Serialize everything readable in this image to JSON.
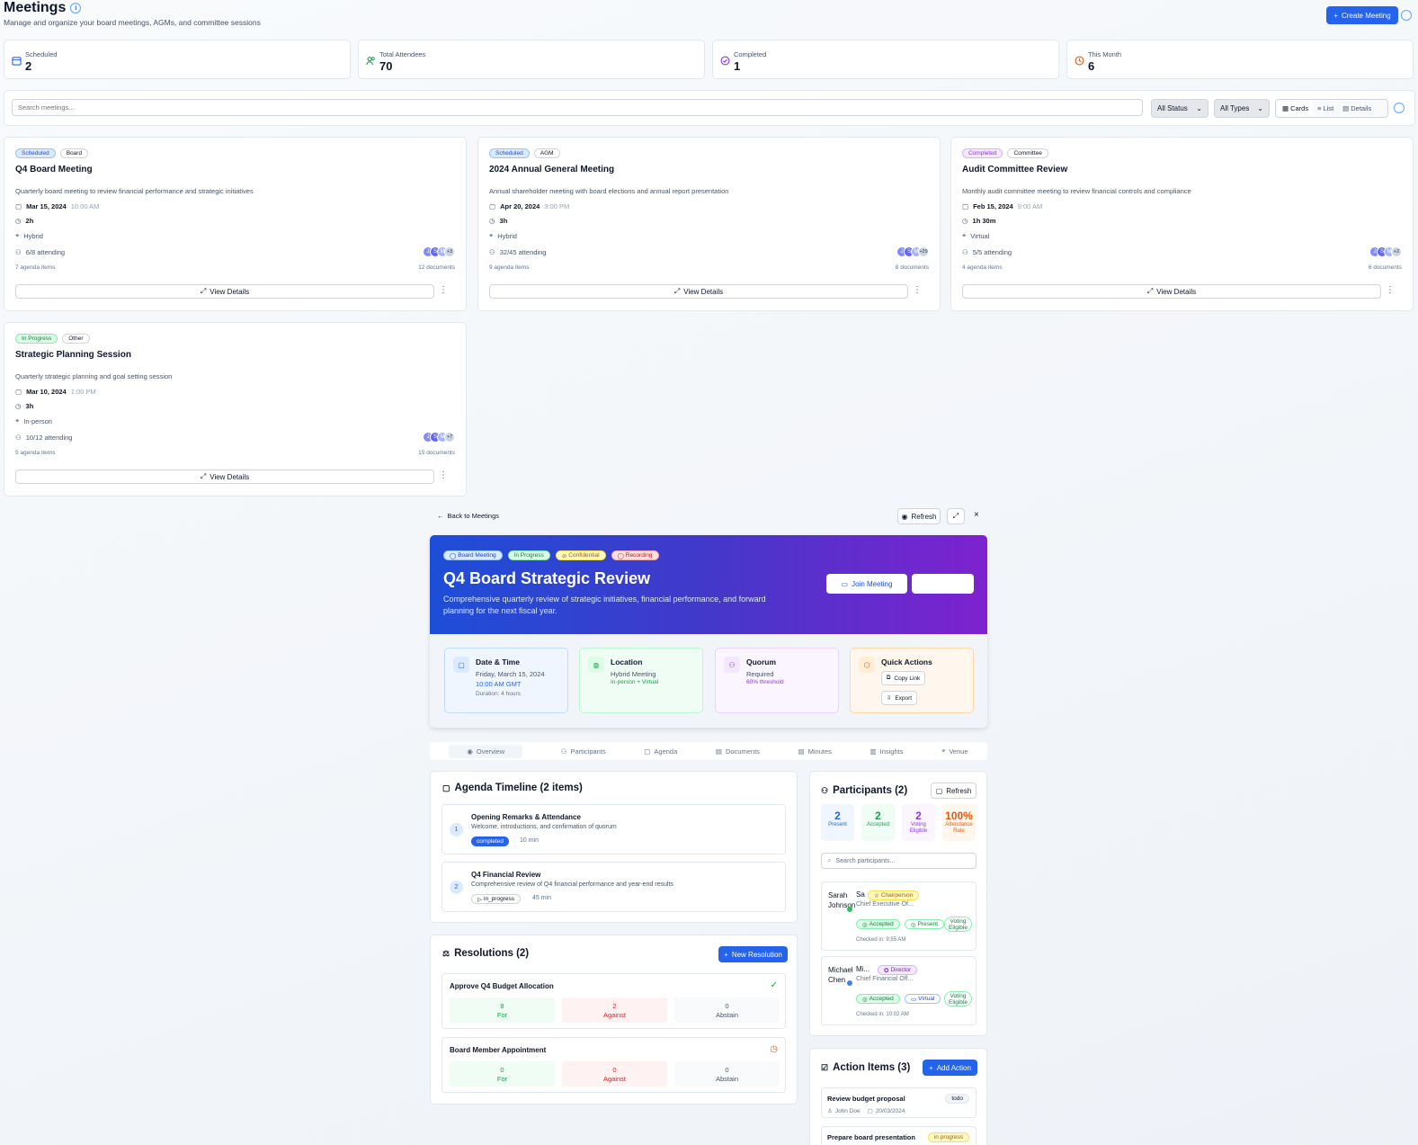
{
  "header": {
    "title": "Meetings",
    "subtitle": "Manage and organize your board meetings, AGMs, and committee sessions",
    "create_label": "Create Meeting"
  },
  "stats": [
    {
      "label": "Scheduled",
      "value": "2",
      "icon": "calendar-icon",
      "color": "#2563eb"
    },
    {
      "label": "Total Attendees",
      "value": "70",
      "icon": "users-icon",
      "color": "#16a34a"
    },
    {
      "label": "Completed",
      "value": "1",
      "icon": "check-circle-icon",
      "color": "#9333ea"
    },
    {
      "label": "This Month",
      "value": "6",
      "icon": "clock-icon",
      "color": "#ea580c"
    }
  ],
  "filters": {
    "search_placeholder": "Search meetings...",
    "status": "All Status",
    "type": "All Types",
    "views": [
      "Cards",
      "List",
      "Details"
    ]
  },
  "meetings": [
    {
      "status": "Scheduled",
      "type": "Board",
      "title": "Q4 Board Meeting",
      "desc": "Quarterly board meeting to review financial performance and strategic initiatives",
      "date": "Mar 15, 2024",
      "time": "10:00 AM",
      "duration": "2h",
      "location": "Hybrid",
      "attending": "6/8 attending",
      "more": "+3",
      "agenda": "7 agenda items",
      "docs": "12 documents"
    },
    {
      "status": "Scheduled",
      "type": "AGM",
      "title": "2024 Annual General Meeting",
      "desc": "Annual shareholder meeting with board elections and annual report presentation",
      "date": "Apr 20, 2024",
      "time": "3:00 PM",
      "duration": "3h",
      "location": "Hybrid",
      "attending": "32/45 attending",
      "more": "+29",
      "agenda": "9 agenda items",
      "docs": "8 documents"
    },
    {
      "status": "Completed",
      "type": "Committee",
      "title": "Audit Committee Review",
      "desc": "Monthly audit committee meeting to review financial controls and compliance",
      "date": "Feb 15, 2024",
      "time": "9:00 AM",
      "duration": "1h 30m",
      "location": "Virtual",
      "attending": "5/5 attending",
      "more": "+2",
      "agenda": "4 agenda items",
      "docs": "6 documents"
    },
    {
      "status": "In Progress",
      "type": "Other",
      "title": "Strategic Planning Session",
      "desc": "Quarterly strategic planning and goal setting session",
      "date": "Mar 10, 2024",
      "time": "1:00 PM",
      "duration": "3h",
      "location": "In-person",
      "attending": "10/12 attending",
      "more": "+7",
      "agenda": "5 agenda items",
      "docs": "15 documents"
    }
  ],
  "view_details": "View Details",
  "detail": {
    "back": "Back to Meetings",
    "refresh": "Refresh",
    "badges": [
      "Board Meeting",
      "In Progress",
      "Confidential",
      "Recording"
    ],
    "title": "Q4 Board Strategic Review",
    "desc": "Comprehensive quarterly review of strategic initiatives, financial performance, and forward planning for the next fiscal year.",
    "join": "Join Meeting",
    "tiles": {
      "date": {
        "title": "Date & Time",
        "l1": "Friday, March 15, 2024",
        "l2": "10:00 AM GMT",
        "l3": "Duration: 4 hours"
      },
      "location": {
        "title": "Location",
        "l1": "Hybrid Meeting",
        "l2": "In-person + Virtual"
      },
      "quorum": {
        "title": "Quorum",
        "l1": "Required",
        "l2": "60% threshold"
      },
      "actions": {
        "title": "Quick Actions",
        "copy": "Copy Link",
        "export": "Export"
      }
    },
    "tabs": [
      "Overview",
      "Participants",
      "Agenda",
      "Documents",
      "Minutes",
      "Insights",
      "Venue"
    ],
    "agenda": {
      "title": "Agenda Timeline (2 items)",
      "items": [
        {
          "n": "1",
          "title": "Opening Remarks & Attendance",
          "desc": "Welcome, introductions, and confirmation of quorum",
          "status": "completed",
          "dur": "10 min"
        },
        {
          "n": "2",
          "title": "Q4 Financial Review",
          "desc": "Comprehensive review of Q4 financial performance and year-end results",
          "status": "in_progress",
          "dur": "45 min"
        }
      ]
    },
    "resolutions": {
      "title": "Resolutions (2)",
      "new": "New Resolution",
      "items": [
        {
          "title": "Approve Q4 Budget Allocation",
          "for": "8",
          "against": "2",
          "abstain": "0"
        },
        {
          "title": "Board Member Appointment",
          "for": "0",
          "against": "0",
          "abstain": "0"
        }
      ],
      "labels": {
        "for": "For",
        "against": "Against",
        "abstain": "Abstain"
      }
    },
    "participants": {
      "title": "Participants (2)",
      "refresh": "Refresh",
      "stats": [
        {
          "n": "2",
          "l": "Present"
        },
        {
          "n": "2",
          "l": "Accepted"
        },
        {
          "n": "2",
          "l": "Voting Eligible"
        },
        {
          "n": "100%",
          "l": "Attendance Rate"
        }
      ],
      "search": "Search participants...",
      "people": [
        {
          "first": "Sarah",
          "last": "Johnson",
          "initial": "Sa",
          "role": "Chairperson",
          "title": "Chief Executive Of...",
          "accepted": "Accepted",
          "mode": "Present",
          "voting": "Voting Eligible",
          "checked": "Checked in: 9:55 AM"
        },
        {
          "first": "Michael",
          "last": "Chen",
          "initial": "Mi...",
          "role": "Director",
          "title": "Chief Financial Off...",
          "accepted": "Accepted",
          "mode": "Virtual",
          "voting": "Voting Eligible",
          "checked": "Checked in: 10:02 AM"
        }
      ]
    },
    "actions": {
      "title": "Action Items (3)",
      "add": "Add Action",
      "items": [
        {
          "title": "Review budget proposal",
          "owner": "John Doe",
          "date": "20/03/2024",
          "status": "todo"
        },
        {
          "title": "Prepare board presentation",
          "status": "in progress"
        }
      ]
    }
  }
}
